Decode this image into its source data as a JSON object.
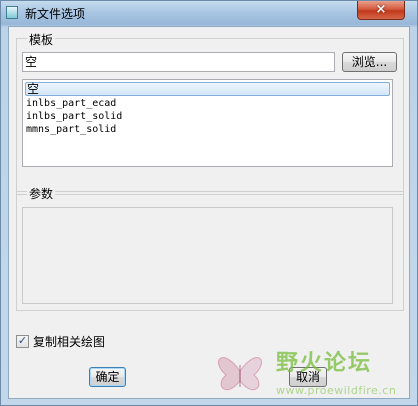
{
  "window": {
    "title": "新文件选项",
    "close_symbol": "×"
  },
  "template": {
    "label": "模板",
    "input_value": "空",
    "browse_label": "浏览...",
    "items": [
      "空",
      "inlbs_part_ecad",
      "inlbs_part_solid",
      "mmns_part_solid"
    ],
    "selected_index": 0
  },
  "params": {
    "label": "参数"
  },
  "copy_drawing": {
    "label": "复制相关绘图",
    "checked": true
  },
  "buttons": {
    "ok_label": "确定",
    "cancel_label": "取消"
  },
  "watermark": {
    "name": "野火论坛",
    "url": "www.proewildfire.cn"
  },
  "icons": {
    "window_icon": "dialog-icon",
    "close_icon": "close-icon",
    "check_icon": "checkmark-icon"
  }
}
